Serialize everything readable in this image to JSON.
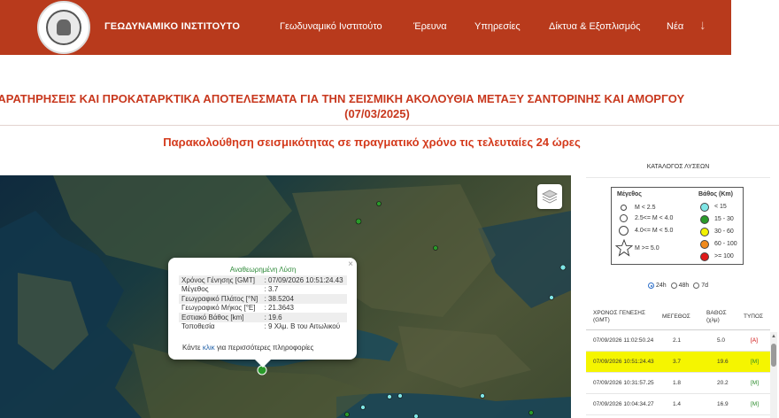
{
  "header": {
    "brand": "ΓΕΩΔΥΝΑΜΙΚΟ ΙΝΣΤΙΤΟΥΤΟ",
    "nav": [
      {
        "label": "Γεωδυναμικό Ινστιτούτο"
      },
      {
        "label": "Έρευνα"
      },
      {
        "label": "Υπηρεσίες"
      },
      {
        "label": "Δίκτυα & Εξοπλισμός"
      },
      {
        "label": "Νέα"
      }
    ],
    "more_icon": "arrow-down-icon"
  },
  "page": {
    "title_line1": "ΠΑΡΑΤΗΡΗΣΕΙΣ ΚΑΙ ΠΡΟΚΑΤΑΡΚΤΙΚΑ ΑΠΟΤΕΛΕΣΜΑΤΑ ΓΙΑ ΤΗΝ ΣΕΙΣΜΙΚΗ ΑΚΟΛΟΥΘΙΑ ΜΕΤΑΞΥ ΣΑΝΤΟΡΙΝΗΣ ΚΑΙ ΑΜΟΡΓΟΥ",
    "title_line2": "(07/03/2025)",
    "subtitle": "Παρακολούθηση σεισμικότητας σε πραγματικό χρόνο τις τελευταίες 24 ώρες"
  },
  "popup": {
    "title": "Αναθεωρημένη Λύση",
    "close": "×",
    "fields": [
      {
        "label": "Χρόνος Γένησης [GMT]",
        "value": ": 07/09/2026 10:51:24.43"
      },
      {
        "label": "Μέγεθος",
        "value": ": 3.7"
      },
      {
        "label": "Γεωγραφικό Πλάτος [°N]",
        "value": ": 38.5204"
      },
      {
        "label": "Γεωγραφικό Μήκος [°E]",
        "value": ": 21.3643"
      },
      {
        "label": "Εστιακό Βάθος [km]",
        "value": ": 19.6"
      },
      {
        "label": "Τοποθεσία",
        "value": ": 9 Χλμ. Β του Αιτωλικού"
      }
    ],
    "more_prefix": "Κάντε ",
    "more_link": "κλικ",
    "more_suffix": " για περισσότερες πληροφορίες"
  },
  "sidebar": {
    "heading": "ΚΑΤΑΛΟΓΟΣ ΛΥΣΕΩΝ",
    "legend": {
      "magnitude_title": "Μέγεθος",
      "depth_title": "Βάθος (Km)",
      "magnitudes": [
        "M < 2.5",
        "2.5<= M < 4.0",
        "4.0<= M < 5.0",
        "M >= 5.0"
      ],
      "depths": [
        {
          "label": "< 15",
          "color": "#7fe6e6"
        },
        {
          "label": "15 - 30",
          "color": "#2a9a2a"
        },
        {
          "label": "30 - 60",
          "color": "#f2f200"
        },
        {
          "label": "60 - 100",
          "color": "#f08a1c"
        },
        {
          "label": ">= 100",
          "color": "#e01a1a"
        }
      ]
    },
    "periods": [
      {
        "label": "24h",
        "selected": true
      },
      {
        "label": "48h",
        "selected": false
      },
      {
        "label": "7d",
        "selected": false
      }
    ],
    "table_headers": {
      "time": "ΧΡΟΝΟΣ ΓΕΝΕΣΗΣ (GMT)",
      "mag": "ΜΕΓΕΘΟΣ",
      "depth": "ΒΑΘΟΣ (χλμ)",
      "type": "ΤΥΠΟΣ"
    },
    "events": [
      {
        "time": "07/09/2026 11:02:50.24",
        "mag": "2.1",
        "depth": "5.0",
        "type": "[A]"
      },
      {
        "time": "07/09/2026 10:51:24.43",
        "mag": "3.7",
        "depth": "19.6",
        "type": "[M]"
      },
      {
        "time": "07/09/2026 10:31:57.25",
        "mag": "1.8",
        "depth": "20.2",
        "type": "[M]"
      },
      {
        "time": "07/09/2026 10:04:34.27",
        "mag": "1.4",
        "depth": "16.9",
        "type": "[M]"
      }
    ]
  },
  "colors": {
    "header_bg": "#b83a1c",
    "title_red": "#c8381e",
    "selected_row": "#f5f500",
    "auto_type": "#cc0000",
    "manual_type": "#2a8a2a"
  }
}
